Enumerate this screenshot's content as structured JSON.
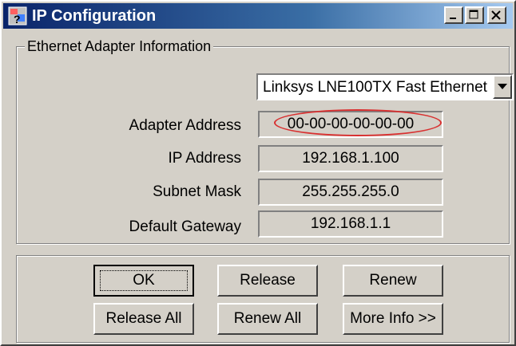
{
  "window": {
    "title": "IP Configuration",
    "controls": {
      "minimize_icon": "minimize-icon",
      "maximize_icon": "maximize-icon",
      "close_icon": "close-icon"
    }
  },
  "group": {
    "legend": "Ethernet  Adapter Information"
  },
  "adapter_select": {
    "value": "Linksys LNE100TX Fast Ethernet"
  },
  "fields": {
    "adapter_address": {
      "label": "Adapter Address",
      "value": "00-00-00-00-00-00"
    },
    "ip_address": {
      "label": "IP Address",
      "value": "192.168.1.100"
    },
    "subnet_mask": {
      "label": "Subnet Mask",
      "value": "255.255.255.0"
    },
    "default_gateway": {
      "label": "Default Gateway",
      "value": "192.168.1.1"
    }
  },
  "buttons": {
    "ok": "OK",
    "release": "Release",
    "renew": "Renew",
    "release_all": "Release All",
    "renew_all": "Renew All",
    "more_info": "More Info >>"
  },
  "colors": {
    "highlight": "#d83030",
    "titlebar": "#0a246a",
    "face": "#d4d0c8"
  }
}
